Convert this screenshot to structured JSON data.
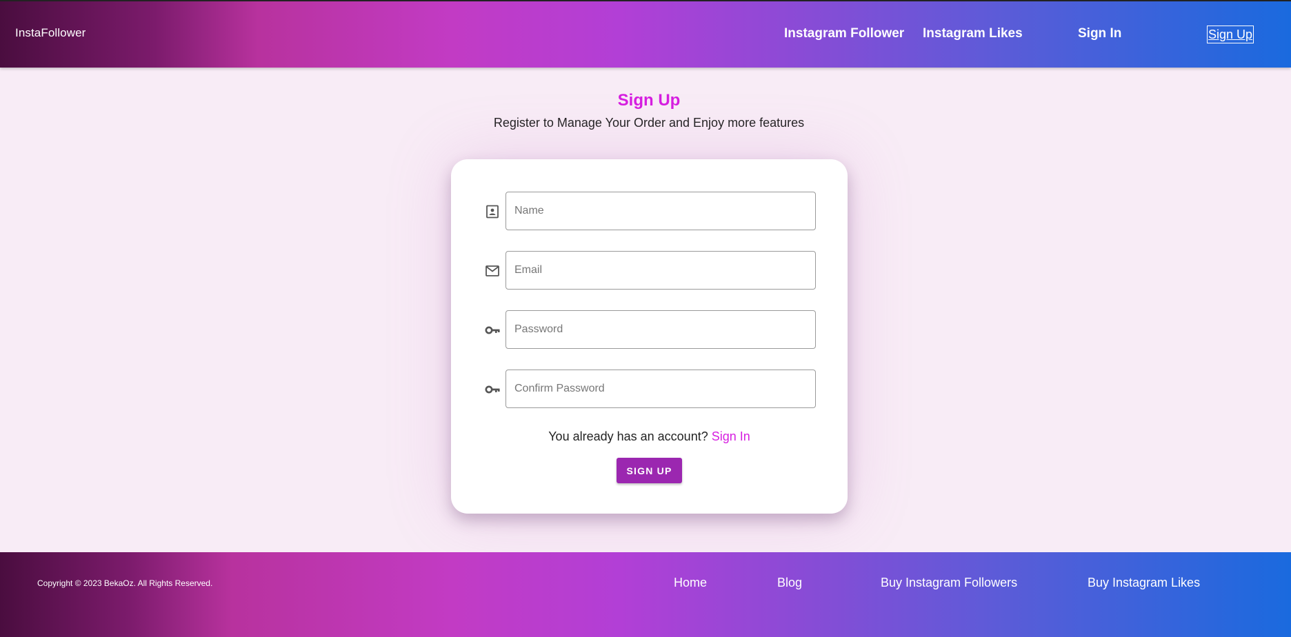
{
  "header": {
    "brand": "InstaFollower",
    "nav": {
      "followers": "Instagram Follower",
      "likes": "Instagram Likes",
      "signin": "Sign In",
      "signup": "Sign Up"
    }
  },
  "page": {
    "title": "Sign Up",
    "subtitle": "Register to Manage Your Order and Enjoy more features"
  },
  "form": {
    "name_placeholder": "Name",
    "email_placeholder": "Email",
    "password_placeholder": "Password",
    "confirm_placeholder": "Confirm Password",
    "account_text": "You already has an account?",
    "account_link": "Sign In",
    "submit_label": "SIGN UP",
    "icons": {
      "name": "contact-icon",
      "email": "mail-icon",
      "password": "key-icon",
      "confirm": "key-icon"
    }
  },
  "footer": {
    "copyright": "Copyright © 2023 BekaOz. All Rights Reserved.",
    "links": {
      "home": "Home",
      "blog": "Blog",
      "buy_followers": "Buy Instagram Followers",
      "buy_likes": "Buy Instagram Likes"
    }
  },
  "colors": {
    "accent": "#d61fe0",
    "button": "#9b27b0",
    "background": "#f8ecf6"
  }
}
